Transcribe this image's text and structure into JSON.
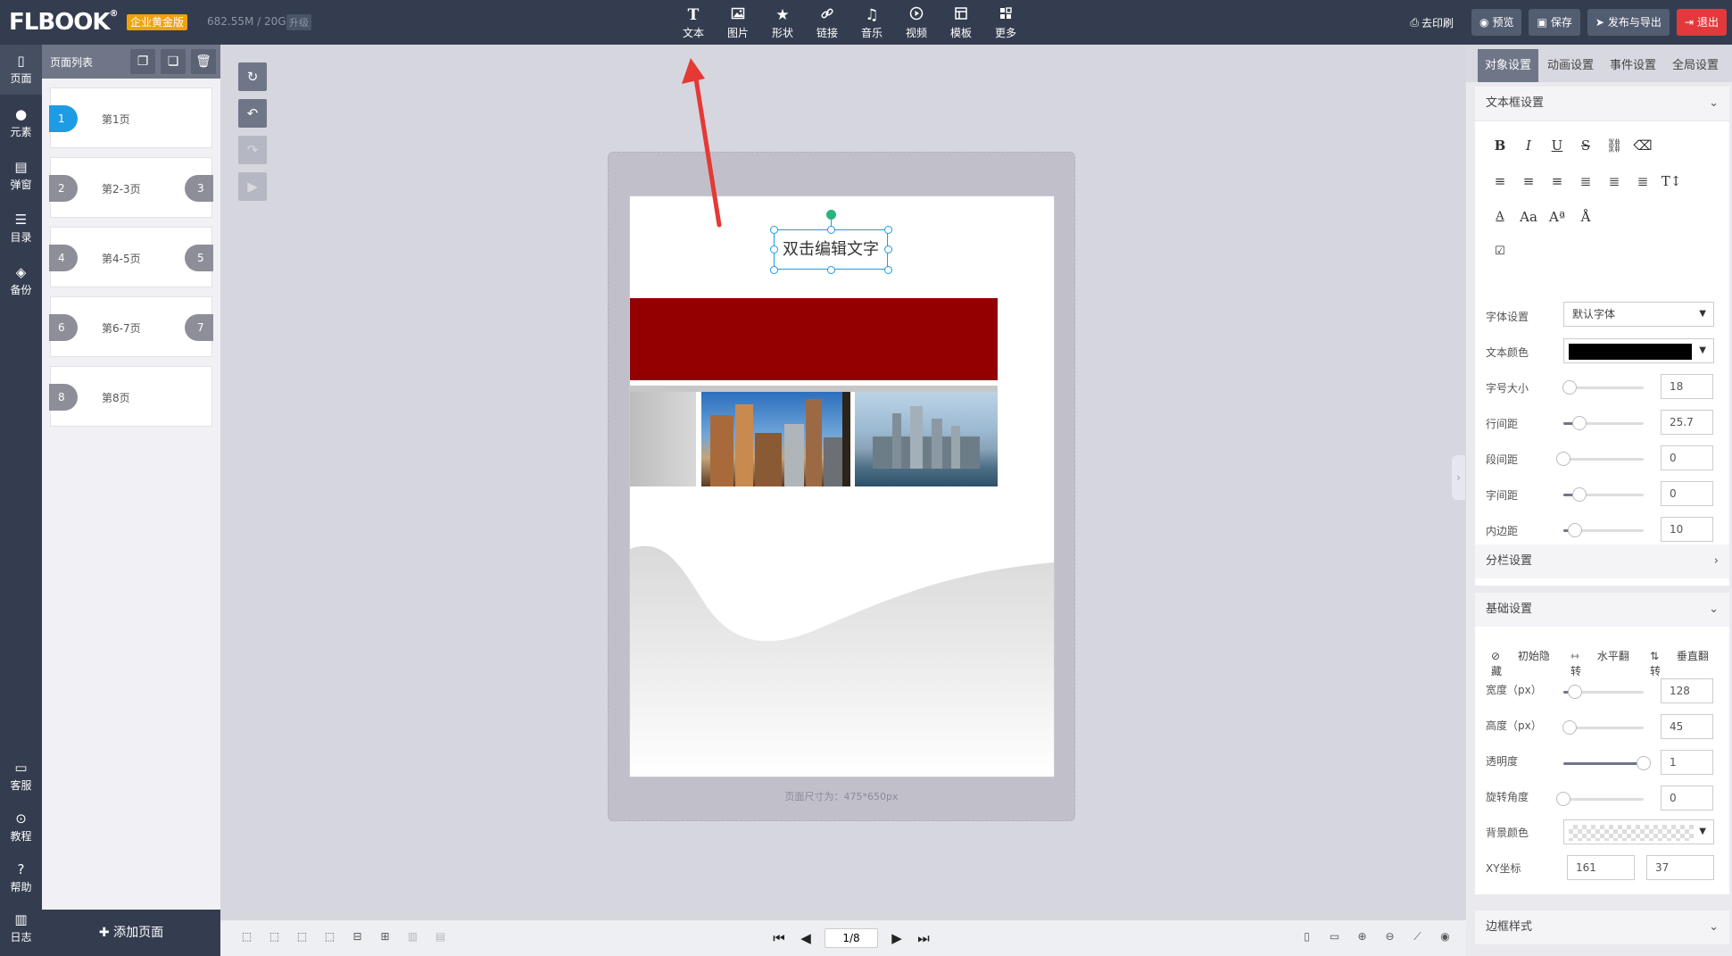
{
  "app": {
    "logo": "FLBOOK",
    "logo_mark": "®",
    "edition": "企业黄金版",
    "storage": "682.55M / 20G",
    "upgrade": "升级"
  },
  "toolbar": {
    "items": [
      {
        "label": "文本",
        "icon": "text-icon"
      },
      {
        "label": "图片",
        "icon": "image-icon"
      },
      {
        "label": "形状",
        "icon": "star-icon"
      },
      {
        "label": "链接",
        "icon": "link-icon"
      },
      {
        "label": "音乐",
        "icon": "music-icon"
      },
      {
        "label": "视频",
        "icon": "video-icon"
      },
      {
        "label": "模板",
        "icon": "template-icon"
      },
      {
        "label": "更多",
        "icon": "more-icon"
      }
    ],
    "print": "去印刷",
    "preview": "预览",
    "save": "保存",
    "publish": "发布与导出",
    "exit": "退出"
  },
  "rail": {
    "top": [
      {
        "label": "页面",
        "icon": "page-icon"
      },
      {
        "label": "元素",
        "icon": "element-icon"
      },
      {
        "label": "弹窗",
        "icon": "popup-icon"
      },
      {
        "label": "目录",
        "icon": "list-icon"
      },
      {
        "label": "备份",
        "icon": "layers-icon"
      }
    ],
    "bottom": [
      {
        "label": "客服",
        "icon": "chat-icon"
      },
      {
        "label": "教程",
        "icon": "play-icon"
      },
      {
        "label": "帮助",
        "icon": "help-icon"
      },
      {
        "label": "日志",
        "icon": "log-icon"
      }
    ]
  },
  "page_list": {
    "title": "页面列表",
    "pages": [
      {
        "num": "1",
        "label": "第1页",
        "num_right": ""
      },
      {
        "num": "2",
        "label": "第2-3页",
        "num_right": "3"
      },
      {
        "num": "4",
        "label": "第4-5页",
        "num_right": "5"
      },
      {
        "num": "6",
        "label": "第6-7页",
        "num_right": "7"
      },
      {
        "num": "8",
        "label": "第8页",
        "num_right": ""
      }
    ],
    "add_page": "添加页面"
  },
  "canvas": {
    "text_box": "双击编辑文字",
    "page_size": "页面尺寸为：475*650px"
  },
  "pager": {
    "current": "1/8"
  },
  "right_panel": {
    "tabs": [
      "对象设置",
      "动画设置",
      "事件设置",
      "全局设置"
    ],
    "text_section": "文本框设置",
    "font_label": "字体设置",
    "font_value": "默认字体",
    "color_label": "文本颜色",
    "text_color": "#000000",
    "size_label": "字号大小",
    "size_value": "18",
    "size_fraction": 0.08,
    "line_label": "行间距",
    "line_value": "25.7",
    "line_fraction": 0.2,
    "para_label": "段间距",
    "para_value": "0",
    "para_fraction": 0,
    "letter_label": "字间距",
    "letter_value": "0",
    "letter_fraction": 0.2,
    "padding_label": "内边距",
    "padding_value": "10",
    "padding_fraction": 0.14,
    "column_section": "分栏设置",
    "basic_section": "基础设置",
    "toggles": [
      "初始隐藏",
      "水平翻转",
      "垂直翻转"
    ],
    "width_label": "宽度（px）",
    "width_value": "128",
    "width_fraction": 0.14,
    "height_label": "高度（px）",
    "height_value": "45",
    "height_fraction": 0.08,
    "opacity_label": "透明度",
    "opacity_value": "1",
    "opacity_fraction": 1,
    "rotation_label": "旋转角度",
    "rotation_value": "0",
    "rotation_fraction": 0,
    "bg_label": "背景颜色",
    "xy_label": "XY坐标",
    "x_value": "161",
    "y_value": "37",
    "border_section": "边框样式"
  },
  "colors": {
    "topbar": "#343d4f",
    "accent": "#1e9be5",
    "danger": "#e4393c",
    "badge": "#f0a20a",
    "red_band": "#940002"
  }
}
